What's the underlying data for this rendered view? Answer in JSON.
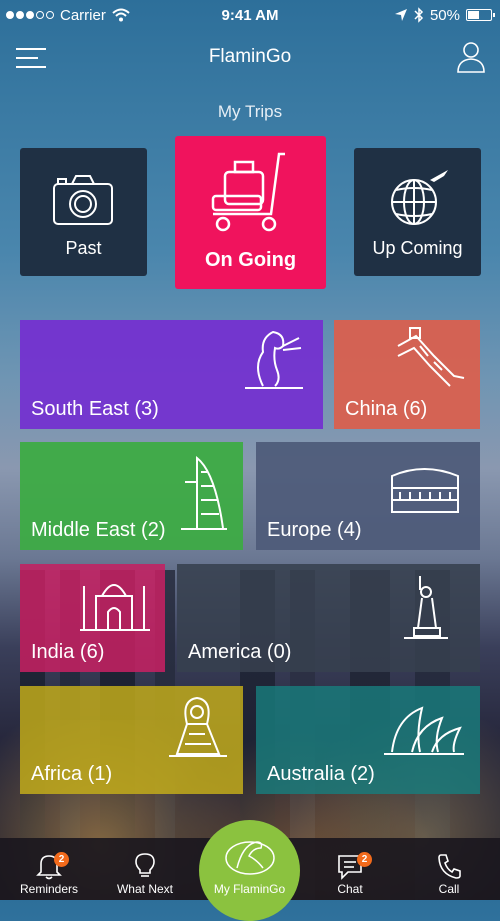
{
  "status_bar": {
    "carrier": "Carrier",
    "time": "9:41 AM",
    "battery": "50%",
    "battery_level": 0.5,
    "signal_bars_filled": 3,
    "signal_bars_total": 5
  },
  "app": {
    "title": "FlaminGo"
  },
  "section": {
    "title": "My Trips"
  },
  "trips": {
    "past": "Past",
    "ongoing": "On Going",
    "upcoming": "Up Coming"
  },
  "regions": {
    "south_east": "South East (3)",
    "china": "China (6)",
    "middle_east": "Middle East (2)",
    "europe": "Europe (4)",
    "india": "India (6)",
    "america": "America (0)",
    "africa": "Africa (1)",
    "australia": "Australia (2)"
  },
  "tabs": {
    "reminders": "Reminders",
    "reminders_badge": "2",
    "what_next": "What Next",
    "my_flamingo": "My FlaminGo",
    "chat": "Chat",
    "chat_badge": "2",
    "call": "Call"
  },
  "colors": {
    "ongoing": "#f0135d",
    "south_east": "#7431d0",
    "china": "#d9604f",
    "middle_east": "#3dab45",
    "europe": "#4d5a78",
    "india": "#c42162",
    "america": "#37404f",
    "africa": "#c7b01a",
    "australia": "#187c7c",
    "center_tab": "#8bc23f",
    "badge": "#f26a1b"
  },
  "icons": {
    "past": "camera-icon",
    "ongoing": "luggage-cart-icon",
    "upcoming": "globe-plane-icon",
    "south_east": "merlion-icon",
    "china": "great-wall-icon",
    "middle_east": "burj-al-arab-icon",
    "europe": "colosseum-icon",
    "india": "taj-mahal-icon",
    "america": "statue-of-liberty-icon",
    "africa": "sphinx-icon",
    "australia": "opera-house-icon"
  }
}
